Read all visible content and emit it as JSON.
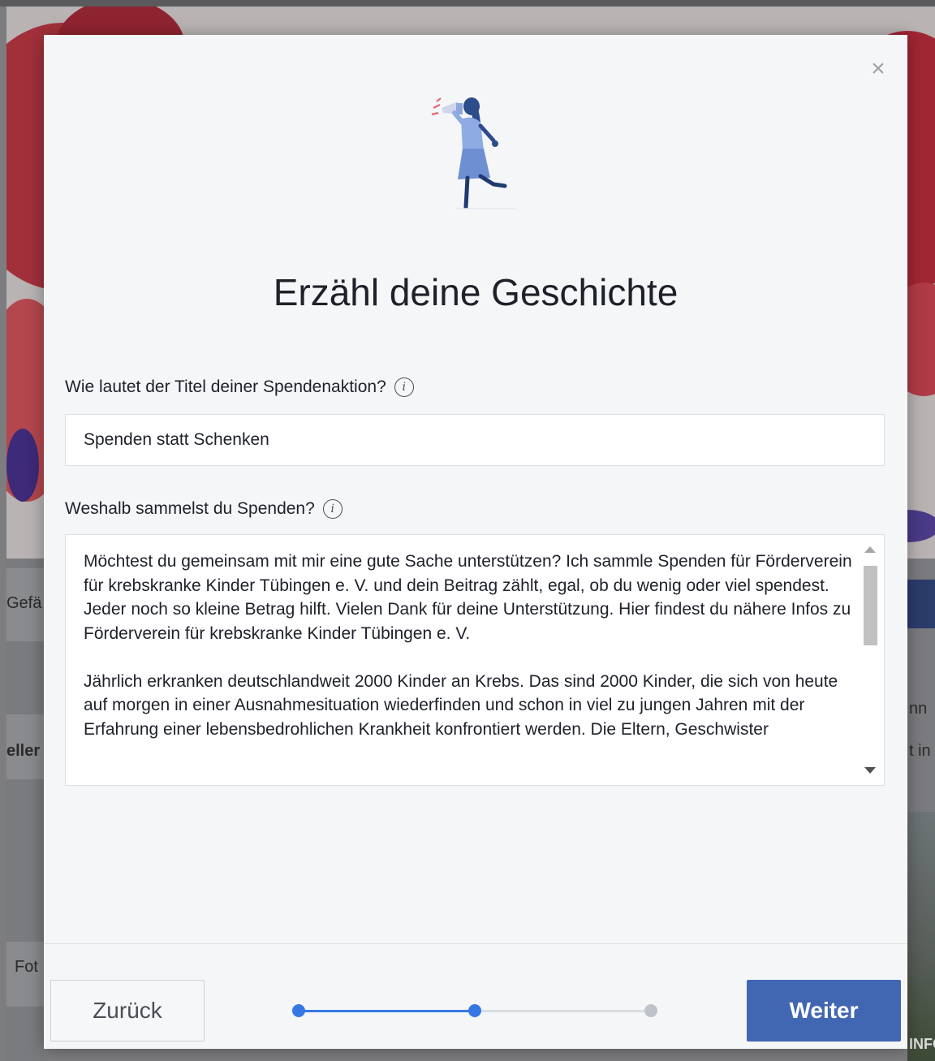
{
  "background": {
    "left_fragments": [
      "Gefä",
      "eller",
      "Fot"
    ],
    "right_fragments": [
      "nn",
      "t in",
      "INFO FÖRD"
    ]
  },
  "modal": {
    "close_label": "×",
    "title": "Erzähl deine Geschichte",
    "fundraiser_title": {
      "label": "Wie lautet der Titel deiner Spendenaktion?",
      "info_glyph": "i",
      "value": "Spenden statt Schenken"
    },
    "reason": {
      "label": "Weshalb sammelst du Spenden?",
      "info_glyph": "i",
      "paragraph1": "Möchtest du gemeinsam mit mir eine gute Sache unterstützen? Ich sammle Spenden für Förderverein für krebskranke Kinder Tübingen e. V. und dein Beitrag zählt, egal, ob du wenig oder viel spendest. Jeder noch so kleine Betrag hilft. Vielen Dank für deine Unterstützung. Hier findest du nähere Infos zu Förderverein für krebskranke Kinder Tübingen e. V.",
      "paragraph2": "Jährlich erkranken deutschlandweit 2000 Kinder an Krebs. Das sind 2000 Kinder, die sich von heute auf morgen in einer Ausnahmesituation wiederfinden und schon in viel zu jungen Jahren mit der Erfahrung einer lebensbedrohlichen Krankheit konfrontiert werden. Die Eltern, Geschwister"
    },
    "footer": {
      "back_label": "Zurück",
      "next_label": "Weiter",
      "steps_total": 3,
      "current_step": 2
    }
  },
  "colors": {
    "primary": "#4267b2",
    "step_active": "#3578e5",
    "step_inactive": "#bec3c9",
    "text": "#1d2129"
  },
  "icons": {
    "close": "close-icon",
    "info": "info-icon",
    "illustration": "megaphone-person-illustration"
  }
}
